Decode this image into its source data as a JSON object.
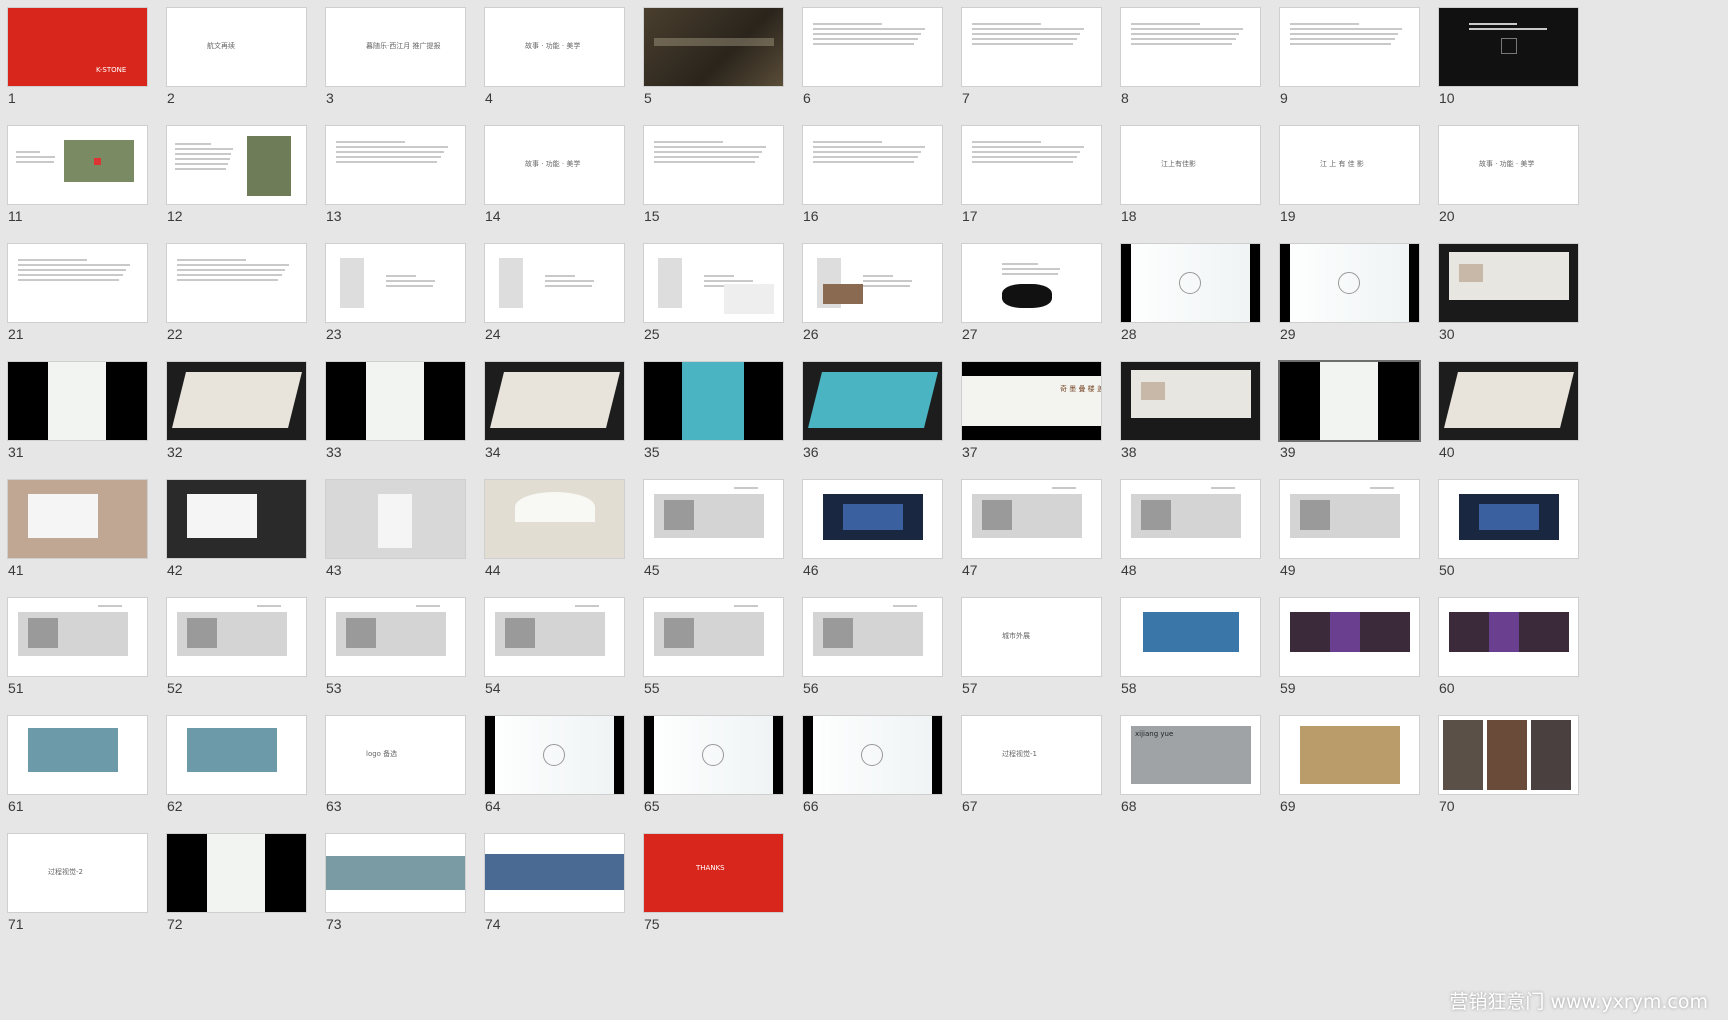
{
  "watermark": "营销狂意门 www.yxrym.com",
  "slides": [
    {
      "n": "1",
      "kind": "red",
      "text": "K-STONE"
    },
    {
      "n": "2",
      "kind": "title",
      "text": "航文再续"
    },
    {
      "n": "3",
      "kind": "title",
      "text": "暮随乐·西江月 推广提报"
    },
    {
      "n": "4",
      "kind": "title",
      "text": "故事 · 功能 · 美学"
    },
    {
      "n": "5",
      "kind": "photo"
    },
    {
      "n": "6",
      "kind": "text"
    },
    {
      "n": "7",
      "kind": "text"
    },
    {
      "n": "8",
      "kind": "text"
    },
    {
      "n": "9",
      "kind": "text"
    },
    {
      "n": "10",
      "kind": "dark"
    },
    {
      "n": "11",
      "kind": "map"
    },
    {
      "n": "12",
      "kind": "map2"
    },
    {
      "n": "13",
      "kind": "text"
    },
    {
      "n": "14",
      "kind": "title",
      "text": "故事 · 功能 · 美学"
    },
    {
      "n": "15",
      "kind": "text"
    },
    {
      "n": "16",
      "kind": "text"
    },
    {
      "n": "17",
      "kind": "text"
    },
    {
      "n": "18",
      "kind": "title",
      "text": "江上有佳影"
    },
    {
      "n": "19",
      "kind": "title",
      "text": "江 上 有 佳 影"
    },
    {
      "n": "20",
      "kind": "title",
      "text": "故事 · 功能 · 美学"
    },
    {
      "n": "21",
      "kind": "text"
    },
    {
      "n": "22",
      "kind": "text"
    },
    {
      "n": "23",
      "kind": "product"
    },
    {
      "n": "24",
      "kind": "product"
    },
    {
      "n": "25",
      "kind": "product"
    },
    {
      "n": "26",
      "kind": "product"
    },
    {
      "n": "27",
      "kind": "ink"
    },
    {
      "n": "28",
      "kind": "logo-bars"
    },
    {
      "n": "29",
      "kind": "logo-bars"
    },
    {
      "n": "30",
      "kind": "board"
    },
    {
      "n": "31",
      "kind": "poster"
    },
    {
      "n": "32",
      "kind": "book"
    },
    {
      "n": "33",
      "kind": "poster"
    },
    {
      "n": "34",
      "kind": "book"
    },
    {
      "n": "35",
      "kind": "wave"
    },
    {
      "n": "36",
      "kind": "wave-book"
    },
    {
      "n": "37",
      "kind": "poster2",
      "text": "奇 墨 叠 楼 盖 墅"
    },
    {
      "n": "38",
      "kind": "board"
    },
    {
      "n": "39",
      "kind": "poster",
      "selected": true
    },
    {
      "n": "40",
      "kind": "book"
    },
    {
      "n": "41",
      "kind": "card"
    },
    {
      "n": "42",
      "kind": "card"
    },
    {
      "n": "43",
      "kind": "bag"
    },
    {
      "n": "44",
      "kind": "umbrella"
    },
    {
      "n": "45",
      "kind": "interior"
    },
    {
      "n": "46",
      "kind": "interior-dark"
    },
    {
      "n": "47",
      "kind": "interior"
    },
    {
      "n": "48",
      "kind": "interior"
    },
    {
      "n": "49",
      "kind": "interior"
    },
    {
      "n": "50",
      "kind": "interior-dark"
    },
    {
      "n": "51",
      "kind": "interior"
    },
    {
      "n": "52",
      "kind": "interior"
    },
    {
      "n": "53",
      "kind": "interior"
    },
    {
      "n": "54",
      "kind": "interior"
    },
    {
      "n": "55",
      "kind": "interior"
    },
    {
      "n": "56",
      "kind": "interior"
    },
    {
      "n": "57",
      "kind": "title",
      "text": "城市外展"
    },
    {
      "n": "58",
      "kind": "blue"
    },
    {
      "n": "59",
      "kind": "color"
    },
    {
      "n": "60",
      "kind": "color"
    },
    {
      "n": "61",
      "kind": "glass"
    },
    {
      "n": "62",
      "kind": "glass"
    },
    {
      "n": "63",
      "kind": "title",
      "text": "logo 备选"
    },
    {
      "n": "64",
      "kind": "logo-bars"
    },
    {
      "n": "65",
      "kind": "logo-bars"
    },
    {
      "n": "66",
      "kind": "logo-bars"
    },
    {
      "n": "67",
      "kind": "title",
      "text": "过程视觉-1"
    },
    {
      "n": "68",
      "kind": "xijiang",
      "text": "xijiang yue"
    },
    {
      "n": "69",
      "kind": "gold"
    },
    {
      "n": "70",
      "kind": "triptych"
    },
    {
      "n": "71",
      "kind": "title",
      "text": "过程视觉-2"
    },
    {
      "n": "72",
      "kind": "poster"
    },
    {
      "n": "73",
      "kind": "banner"
    },
    {
      "n": "74",
      "kind": "banner2"
    },
    {
      "n": "75",
      "kind": "red",
      "text": "THANKS"
    }
  ]
}
